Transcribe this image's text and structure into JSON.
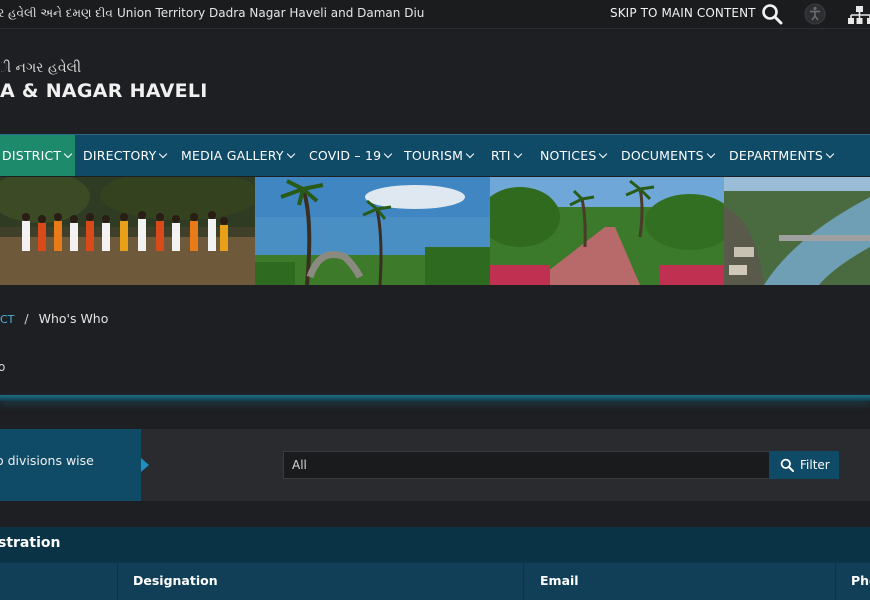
{
  "topbar": {
    "gujarati_text": "ર હવેલી અને દમણ દીવ",
    "title": "Union Territory Dadra Nagar Haveli and Daman Diu",
    "skip_link": "SKIP TO MAIN CONTENT"
  },
  "header": {
    "gujarati_name": "ી નગર હવેલી",
    "english_name": "A & NAGAR HAVELI"
  },
  "nav": {
    "items": [
      {
        "label": "DISTRICT"
      },
      {
        "label": "DIRECTORY"
      },
      {
        "label": "MEDIA GALLERY"
      },
      {
        "label": "COVID – 19"
      },
      {
        "label": "TOURISM"
      },
      {
        "label": "RTI"
      },
      {
        "label": "NOTICES"
      },
      {
        "label": "DOCUMENTS"
      },
      {
        "label": "DEPARTMENTS"
      }
    ]
  },
  "breadcrumb": {
    "parent": "CT",
    "separator": "/",
    "current": "Who's Who"
  },
  "page_heading_fragment": "o",
  "filter": {
    "tab_label": "o divisions wise",
    "select_value": "All",
    "button_label": "Filter"
  },
  "table": {
    "title": "stration",
    "columns": [
      "Designation",
      "Email",
      "Pho"
    ]
  },
  "colors": {
    "nav_bg": "#0f4a66",
    "nav_active": "#1e8a6c",
    "link": "#4fb3d9",
    "page_bg": "#1e1f22"
  }
}
